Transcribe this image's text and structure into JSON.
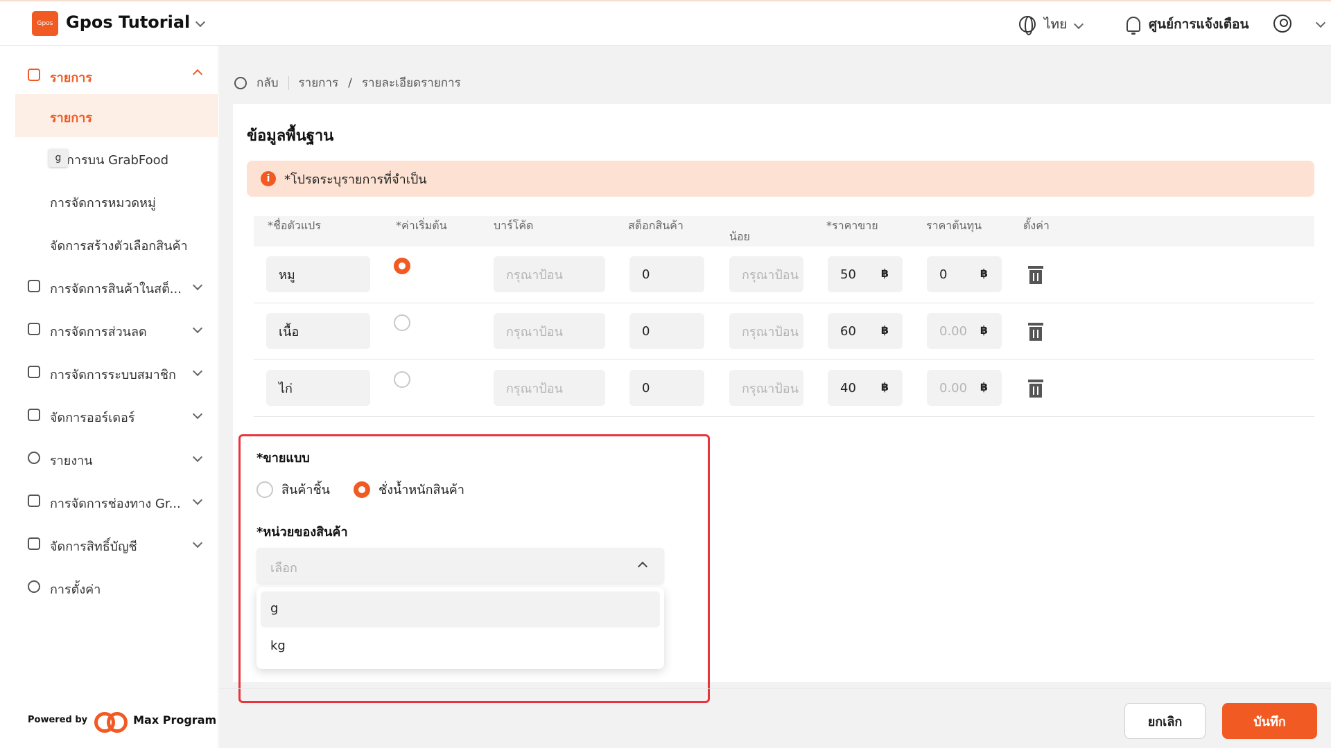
{
  "header": {
    "app_title": "Gpos Tutorial",
    "logo_text": "Gpos",
    "language": "ไทย",
    "notification_center": "ศูนย์การแจ้งเตือน"
  },
  "sidebar": {
    "section_title": "รายการ",
    "sub_items": [
      {
        "label": "รายการ"
      },
      {
        "label": "การบน GrabFood"
      },
      {
        "label": "การจัดการหมวดหมู่"
      },
      {
        "label": "จัดการสร้างตัวเลือกสินค้า"
      }
    ],
    "tooltip": "g",
    "items": [
      {
        "label": "การจัดการสินค้าในสต็..."
      },
      {
        "label": "การจัดการส่วนลด"
      },
      {
        "label": "การจัดการระบบสมาชิก"
      },
      {
        "label": "จัดการออร์เดอร์"
      },
      {
        "label": "รายงาน"
      },
      {
        "label": "การจัดการช่องทาง Gr..."
      },
      {
        "label": "จัดการสิทธิ์บัญชี"
      },
      {
        "label": "การตั้งค่า"
      }
    ],
    "powered_by": "Powered by",
    "brand": "Max Program"
  },
  "breadcrumb": {
    "back": "กลับ",
    "items": [
      "รายการ",
      "/",
      "รายละเอียดรายการ"
    ]
  },
  "form": {
    "section_title": "ข้อมูลพื้นฐาน",
    "alert": "*โปรดระบุรายการที่จำเป็น",
    "table": {
      "headers": [
        "*ชื่อตัวแปร",
        "*ค่าเริ่มต้น",
        "บาร์โค้ด",
        "สต็อกสินค้า",
        "น้อย",
        "*ราคาขาย",
        "ราคาต้นทุน",
        "ตั้งค่า"
      ],
      "rows": [
        {
          "name": "หมู",
          "default": true,
          "barcode": "กรุณาป้อน",
          "stock": "0",
          "min": "กรุณาป้อน",
          "price": "50",
          "cost": "0",
          "cost_is_placeholder": false
        },
        {
          "name": "เนื้อ",
          "default": false,
          "barcode": "กรุณาป้อน",
          "stock": "0",
          "min": "กรุณาป้อน",
          "price": "60",
          "cost": "0.00",
          "cost_is_placeholder": true
        },
        {
          "name": "ไก่",
          "default": false,
          "barcode": "กรุณาป้อน",
          "stock": "0",
          "min": "กรุณาป้อน",
          "price": "40",
          "cost": "0.00",
          "cost_is_placeholder": true
        }
      ],
      "currency": "฿"
    },
    "sell_by": {
      "label": "*ขายแบบ",
      "options": [
        "สินค้าชิ้น",
        "ชั่งน้ำหนักสินค้า"
      ],
      "selected": "ชั่งน้ำหนักสินค้า"
    },
    "unit": {
      "label": "*หน่วยของสินค้า",
      "placeholder": "เลือก",
      "options": [
        "g",
        "kg"
      ]
    }
  },
  "footer": {
    "cancel": "ยกเลิก",
    "save": "บันทึก"
  },
  "colors": {
    "accent": "#f15a22",
    "highlight_border": "#e8343a",
    "alert_bg": "#fde2d3"
  }
}
